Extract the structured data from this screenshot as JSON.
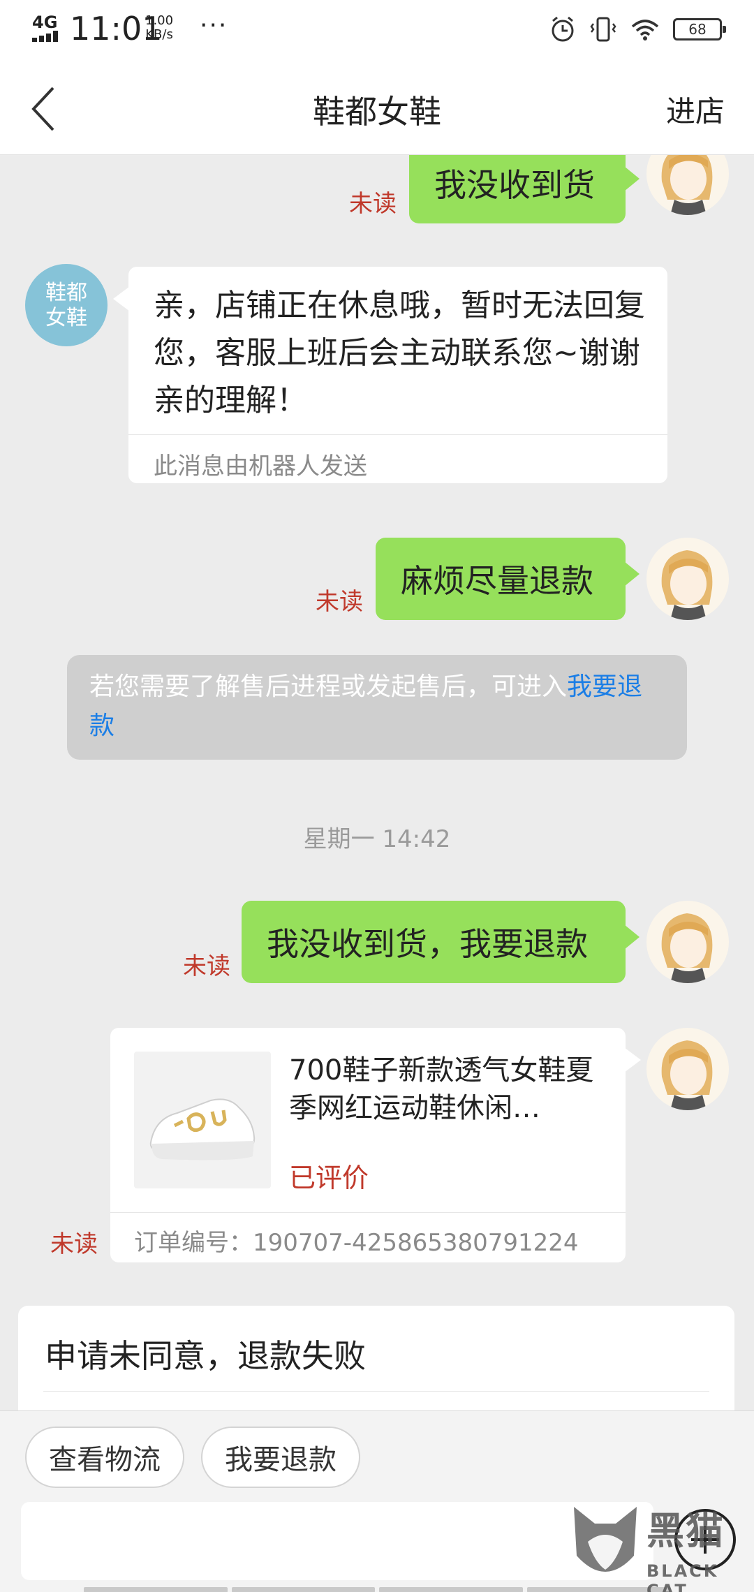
{
  "status_bar": {
    "network": "4G",
    "time": "11:01",
    "speed_value": "1.00",
    "speed_unit": "KB/s",
    "more": "···",
    "battery": "68"
  },
  "nav": {
    "title": "鞋都女鞋",
    "enter_store": "进店"
  },
  "chat": {
    "unread_label": "未读",
    "shop_avatar_line1": "鞋都",
    "shop_avatar_line2": "女鞋",
    "msg1": "我没收到货",
    "robot_reply": "亲，店铺正在休息哦，暂时无法回复您，客服上班后会主动联系您~谢谢亲的理解！",
    "robot_note": "此消息由机器人发送",
    "msg2": "麻烦尽量退款",
    "system_notice": "若您需要了解售后进程或发起售后，可进入",
    "system_link": "我要退款",
    "timestamp": "星期一 14:42",
    "msg3": "我没收到货，我要退款",
    "product": {
      "title": "700鞋子新款透气女鞋夏季网红运动鞋休闲…",
      "status": "已评价",
      "order_label": "订单编号：",
      "order_number": "190707-425865380791224"
    },
    "refund_status": "申请未同意，退款失败"
  },
  "bottom": {
    "logistics_button": "查看物流",
    "refund_button": "我要退款"
  },
  "watermark": {
    "text": "黑猫",
    "sub": "BLACK CAT"
  },
  "colors": {
    "bubble_green": "#96e05b",
    "unread_red": "#c0392b",
    "link_blue": "#1b7ee6",
    "shop_avatar": "#86c3d8"
  }
}
